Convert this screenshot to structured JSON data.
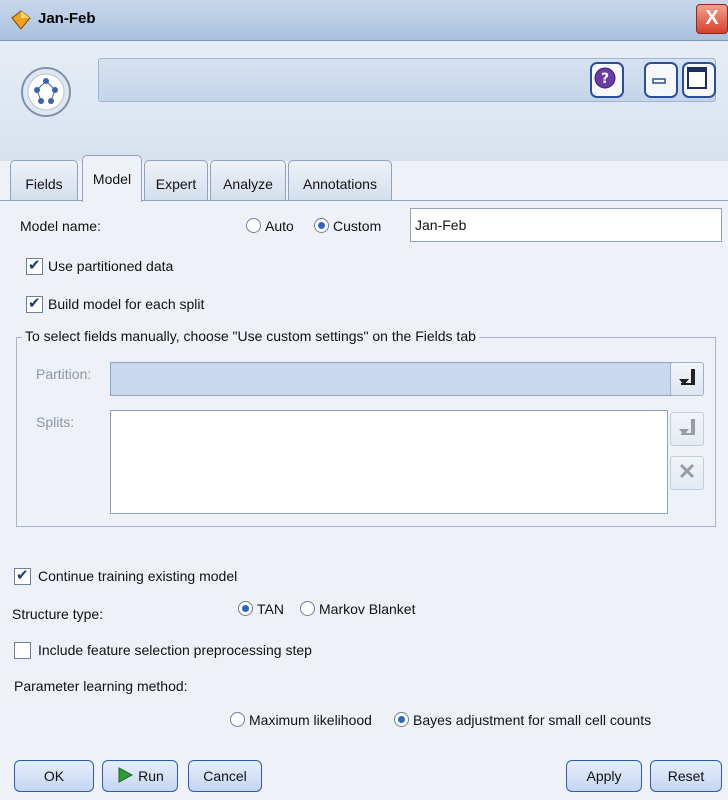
{
  "window": {
    "title": "Jan-Feb",
    "close_glyph": "X"
  },
  "tabs": [
    {
      "label": "Fields"
    },
    {
      "label": "Model"
    },
    {
      "label": "Expert"
    },
    {
      "label": "Analyze"
    },
    {
      "label": "Annotations"
    }
  ],
  "model": {
    "name_label": "Model name:",
    "auto_label": "Auto",
    "custom_label": "Custom",
    "name_mode": "Custom",
    "name_value": "Jan-Feb",
    "use_partitioned_label": "Use partitioned data",
    "use_partitioned_checked": true,
    "build_split_label": "Build model for each split",
    "build_split_checked": true,
    "fieldset_legend": "To select fields manually, choose \"Use custom settings\" on the Fields tab",
    "partition_label": "Partition:",
    "splits_label": "Splits:",
    "continue_training_label": "Continue training existing model",
    "continue_training_checked": true,
    "structure_label": "Structure type:",
    "structure_tan_label": "TAN",
    "structure_markov_label": "Markov Blanket",
    "structure_selected": "TAN",
    "feature_selection_label": "Include feature selection preprocessing step",
    "feature_selection_checked": false,
    "param_method_label": "Parameter learning method:",
    "param_ml_label": "Maximum likelihood",
    "param_bayes_label": "Bayes adjustment for small cell counts",
    "param_selected": "Bayes adjustment for small cell counts"
  },
  "buttons": {
    "ok": "OK",
    "run": "Run",
    "cancel": "Cancel",
    "apply": "Apply",
    "reset": "Reset"
  },
  "colors": {
    "accent": "#2e66c4",
    "window_bg": "#eef2f8",
    "close": "#d4412c",
    "run_play": "#2f9a3a"
  }
}
